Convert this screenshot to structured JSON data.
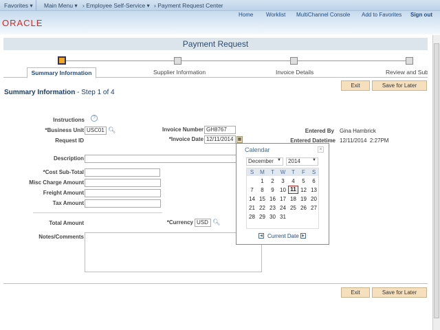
{
  "topbar": {
    "favorites": "Favorites",
    "main_menu": "Main Menu",
    "ess": "Employee Self-Service",
    "current": "Payment Request Center"
  },
  "nav": {
    "home": "Home",
    "worklist": "Worklist",
    "multichannel": "MultiChannel Console",
    "add_fav": "Add to Favorites",
    "signout": "Sign out"
  },
  "logo": "ORACLE",
  "page_title": "Payment Request",
  "steps": [
    {
      "label": "Summary Information",
      "active": true
    },
    {
      "label": "Supplier Information"
    },
    {
      "label": "Invoice Details"
    },
    {
      "label": "Review and Submit"
    }
  ],
  "buttons": {
    "exit": "Exit",
    "save": "Save for Later"
  },
  "section": {
    "title": "Summary Information",
    "step": " - Step 1 of 4"
  },
  "form": {
    "instructions": "Instructions",
    "business_unit": "*Business Unit",
    "business_unit_value": "USC01",
    "request_id": "Request ID",
    "invoice_number": "Invoice Number",
    "invoice_number_value": "GH8767",
    "invoice_date": "*Invoice Date",
    "invoice_date_value": "12/11/2014",
    "entered_by": "Entered By",
    "entered_by_value": "Gina Hambrick",
    "entered_datetime": "Entered Datetime",
    "entered_datetime_value": "12/11/2014  2:27PM",
    "description": "Description",
    "cost_subtotal": "*Cost Sub-Total",
    "misc_charge": "Misc Charge Amount",
    "freight": "Freight Amount",
    "tax": "Tax Amount",
    "total": "Total Amount",
    "currency": "*Currency",
    "currency_value": "USD",
    "notes": "Notes/Comments"
  },
  "calendar": {
    "title": "Calendar",
    "month": "December",
    "year": "2014",
    "weekdays": [
      "S",
      "M",
      "T",
      "W",
      "T",
      "F",
      "S"
    ],
    "first_weekday": 1,
    "days_in_month": 31,
    "selected": 11,
    "current_date": "Current Date"
  }
}
